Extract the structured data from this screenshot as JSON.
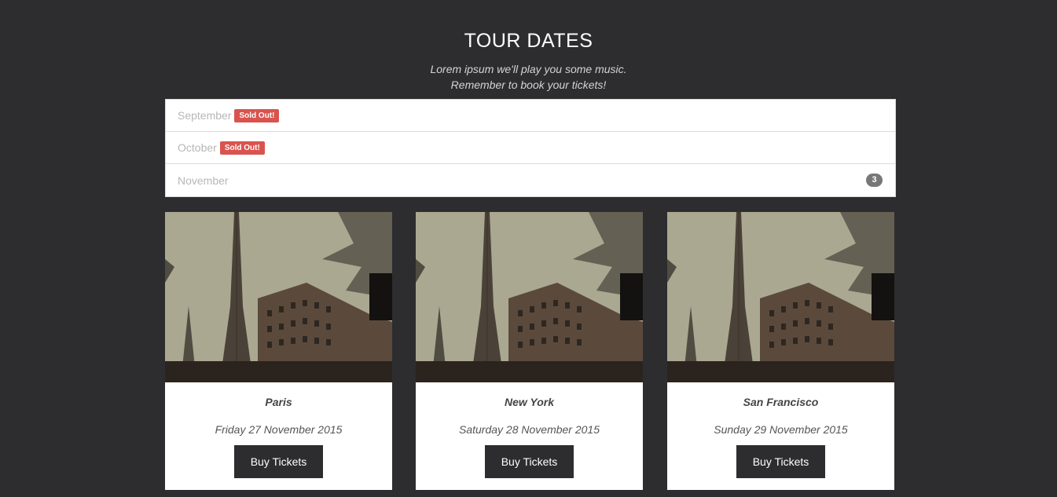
{
  "header": {
    "title": "TOUR DATES",
    "subtitle_line1": "Lorem ipsum we'll play you some music.",
    "subtitle_line2": "Remember to book your tickets!"
  },
  "months": [
    {
      "label": "September",
      "badge": "Sold Out!"
    },
    {
      "label": "October",
      "badge": "Sold Out!"
    },
    {
      "label": "November",
      "count": "3"
    }
  ],
  "tours": [
    {
      "city": "Paris",
      "date": "Friday 27 November 2015",
      "button": "Buy Tickets",
      "image": "eiffel-tower-photo"
    },
    {
      "city": "New York",
      "date": "Saturday 28 November 2015",
      "button": "Buy Tickets",
      "image": "eiffel-tower-photo"
    },
    {
      "city": "San Francisco",
      "date": "Sunday 29 November 2015",
      "button": "Buy Tickets",
      "image": "eiffel-tower-photo"
    }
  ],
  "colors": {
    "background": "#2d2d2f",
    "sold_out_badge": "#d9534f",
    "count_badge": "#777777",
    "button": "#2d2d2f"
  }
}
